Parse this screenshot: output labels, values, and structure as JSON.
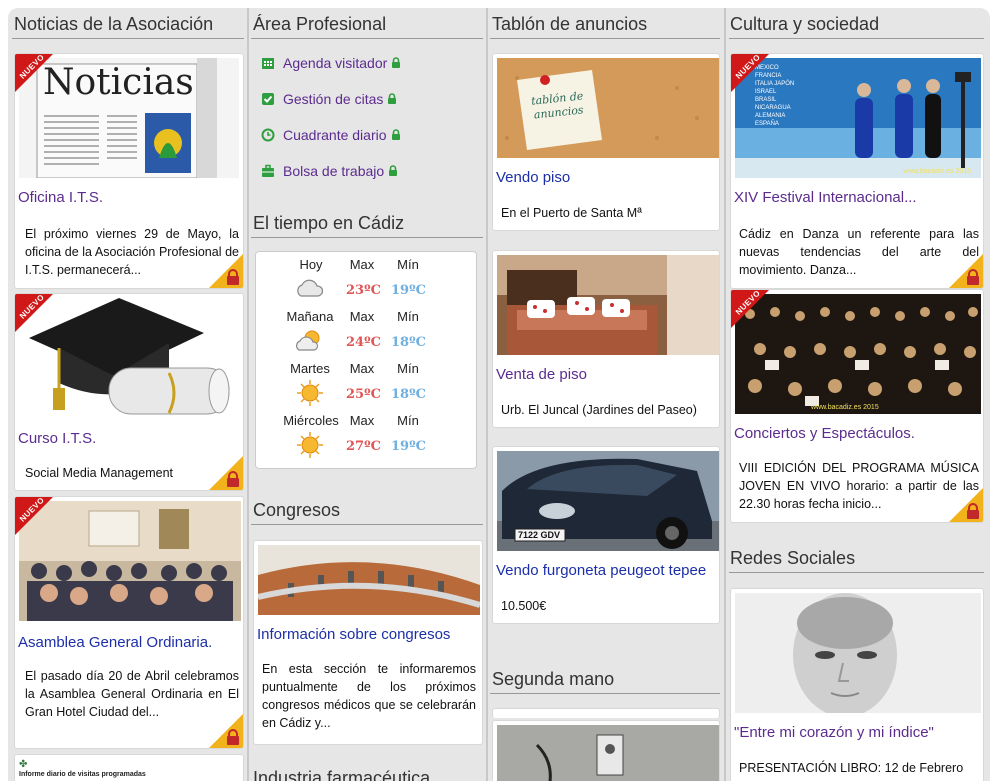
{
  "columns": {
    "news": {
      "title": "Noticias de la Asociación",
      "cards": [
        {
          "badge": "NUEVO",
          "image_text": "Noticias",
          "title": "Oficina I.T.S.",
          "text": "El próximo viernes 29 de Mayo, la oficina de la Asociación Profesional de I.T.S. permanecerá..."
        },
        {
          "badge": "NUEVO",
          "title": "Curso I.T.S.",
          "text": "Social Media Management"
        },
        {
          "badge": "NUEVO",
          "title": "Asamblea General Ordinaria.",
          "text": "El pasado día 20 de Abril celebramos la Asamblea General Ordinaria en El Gran Hotel Ciudad del..."
        },
        {
          "image_text": "Informe diario de visitas programadas"
        }
      ]
    },
    "professional": {
      "title": "Área Profesional",
      "menu": [
        {
          "label": "Agenda visitador",
          "icon": "calendar-icon"
        },
        {
          "label": "Gestión de citas",
          "icon": "checkbox-icon"
        },
        {
          "label": "Cuadrante diario",
          "icon": "clock-icon"
        },
        {
          "label": "Bolsa de trabajo",
          "icon": "briefcase-icon"
        }
      ],
      "weather": {
        "title": "El tiempo en Cádiz",
        "max_label": "Max",
        "min_label": "Mín",
        "days": [
          {
            "day": "Hoy",
            "max": "23ºC",
            "min": "19ºC",
            "icon": "cloud-icon"
          },
          {
            "day": "Mañana",
            "max": "24ºC",
            "min": "18ºC",
            "icon": "sun-cloud-icon"
          },
          {
            "day": "Martes",
            "max": "25ºC",
            "min": "18ºC",
            "icon": "sun-icon"
          },
          {
            "day": "Miércoles",
            "max": "27ºC",
            "min": "19ºC",
            "icon": "sun-icon"
          }
        ]
      },
      "congresos": {
        "title": "Congresos",
        "card_title": "Información sobre congresos",
        "card_text": "En esta sección te informaremos puntualmente de los próximos congresos médicos que se celebrarán en Cádiz y..."
      },
      "industria_title": "Industria farmacéutica"
    },
    "board": {
      "title": "Tablón de anuncios",
      "cards": [
        {
          "image_text": "tablón de anuncios",
          "title": "Vendo piso",
          "text": "En el Puerto de Santa Mª"
        },
        {
          "title": "Venta de piso",
          "text": "Urb. El Juncal (Jardines del Paseo)"
        },
        {
          "image_text": "7122 GDV",
          "title": "Vendo furgoneta peugeot tepee",
          "text": "10.500€"
        }
      ],
      "segunda_mano": "Segunda mano"
    },
    "culture": {
      "title": "Cultura y sociedad",
      "cards": [
        {
          "badge": "NUEVO",
          "image_text": "MEXICO FRANCIA ITALIA JAPÓN ISRAEL BRASIL NICARAGUA ALEMANIA ESPAÑA",
          "watermark": "www.bacadiz.es 2015",
          "title": "XIV Festival Internacional...",
          "text": "Cádiz en Danza un referente para las nuevas tendencias del arte del movimiento. Danza..."
        },
        {
          "badge": "NUEVO",
          "watermark": "www.bacadiz.es 2015",
          "title": "Conciertos y Espectáculos.",
          "text": "VIII EDICIÓN DEL PROGRAMA MÚSICA JOVEN EN VIVO horario: a partir de las 22.30 horas  fecha inicio..."
        }
      ],
      "social": {
        "title": "Redes Sociales",
        "card_title": "\"Entre mi corazón y mi índice\"",
        "card_text": "PRESENTACIÓN LIBRO: 12 de Febrero"
      }
    }
  },
  "colors": {
    "link_purple": "#5b2c8e",
    "link_blue": "#1c2fa8",
    "ribbon_red": "#d01818",
    "lock_orange": "#f2b21b",
    "icon_green": "#2e9e3e",
    "temp_max": "#e05555",
    "temp_min": "#6fb0e0"
  }
}
